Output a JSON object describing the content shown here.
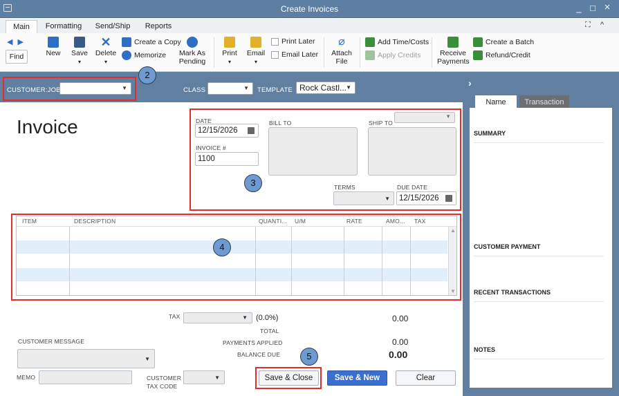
{
  "window": {
    "title": "Create Invoices",
    "min": "_",
    "max": "□",
    "close": "×"
  },
  "tabs": [
    {
      "label": "Main",
      "active": true
    },
    {
      "label": "Formatting"
    },
    {
      "label": "Send/Ship"
    },
    {
      "label": "Reports"
    }
  ],
  "tab_controls": {
    "expand": "⛶",
    "collapse": "^"
  },
  "ribbon": {
    "find": "Find",
    "new": "New",
    "save": "Save",
    "delete": "Delete",
    "create_copy": "Create a Copy",
    "memorize": "Memorize",
    "mark_as_pending_1": "Mark As",
    "mark_as_pending_2": "Pending",
    "print": "Print",
    "email": "Email",
    "print_later": "Print Later",
    "email_later": "Email Later",
    "attach_file_1": "Attach",
    "attach_file_2": "File",
    "add_time_costs": "Add Time/Costs",
    "apply_credits": "Apply Credits",
    "receive_payments_1": "Receive",
    "receive_payments_2": "Payments",
    "create_batch": "Create a Batch",
    "refund_credit": "Refund/Credit",
    "dropdown_arrow": "▾"
  },
  "header": {
    "customer_job_label": "CUSTOMER:JOB",
    "customer_job_value": "",
    "class_label": "CLASS",
    "class_value": "",
    "template_label": "TEMPLATE",
    "template_value": "Rock Castl..."
  },
  "invoice": {
    "title": "Invoice",
    "date_label": "DATE",
    "date_value": "12/15/2026",
    "invoice_no_label": "INVOICE #",
    "invoice_no_value": "1100",
    "bill_to_label": "BILL TO",
    "ship_to_label": "SHIP TO",
    "terms_label": "TERMS",
    "due_date_label": "DUE DATE",
    "due_date_value": "12/15/2026"
  },
  "grid": {
    "columns": [
      "ITEM",
      "DESCRIPTION",
      "QUANTI...",
      "U/M",
      "RATE",
      "AMO...",
      "TAX"
    ]
  },
  "totals": {
    "tax_label": "TAX",
    "tax_rate": "(0.0%)",
    "tax_value": "0.00",
    "total_label": "TOTAL",
    "payments_applied_label": "PAYMENTS APPLIED",
    "payments_applied_value": "0.00",
    "balance_due_label": "BALANCE DUE",
    "balance_due_value": "0.00"
  },
  "footer": {
    "customer_message_label": "CUSTOMER MESSAGE",
    "memo_label": "MEMO",
    "customer_tax_code_label_1": "CUSTOMER",
    "customer_tax_code_label_2": "TAX CODE",
    "save_close": "Save & Close",
    "save_new": "Save & New",
    "clear": "Clear"
  },
  "side_panel": {
    "toggle": "›",
    "tab_name": "Name",
    "tab_transaction": "Transaction",
    "summary": "SUMMARY",
    "customer_payment": "CUSTOMER PAYMENT",
    "recent_transactions": "RECENT TRANSACTIONS",
    "notes": "NOTES"
  },
  "callouts": [
    "2",
    "3",
    "4",
    "5"
  ],
  "colors": {
    "title_bar": "#5d7fa3",
    "header_band": "#617fa0",
    "highlight_red": "#e32d2d",
    "callout_fill": "#6d9ad0",
    "primary_button": "#3a6fcf",
    "grid_alt_row": "#e3eefb"
  }
}
